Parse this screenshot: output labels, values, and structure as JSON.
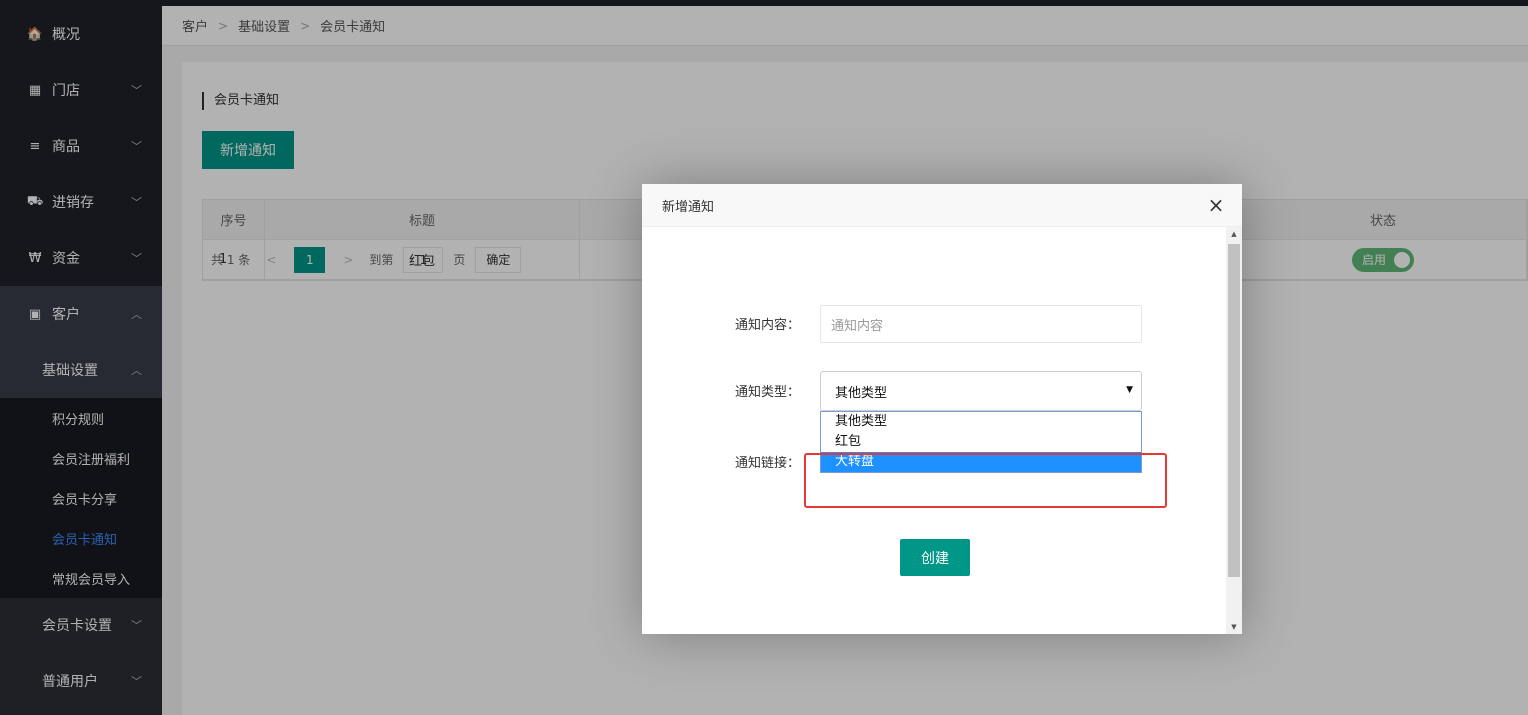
{
  "sidebar": {
    "items": [
      {
        "label": "概况",
        "icon": "home-icon",
        "glyph": "🏠",
        "arrow": ""
      },
      {
        "label": "门店",
        "icon": "building-icon",
        "glyph": "▦",
        "arrow": "﹀"
      },
      {
        "label": "商品",
        "icon": "list-icon",
        "glyph": "≡",
        "arrow": "﹀"
      },
      {
        "label": "进销存",
        "icon": "truck-icon",
        "glyph": "⛟",
        "arrow": "﹀"
      },
      {
        "label": "资金",
        "icon": "won-icon",
        "glyph": "₩",
        "arrow": "﹀"
      },
      {
        "label": "客户",
        "icon": "id-card-icon",
        "glyph": "▣",
        "arrow": "︿"
      }
    ],
    "sub_group": {
      "label": "基础设置",
      "arrow": "︿",
      "leaves": [
        "积分规则",
        "会员注册福利",
        "会员卡分享",
        "会员卡通知",
        "常规会员导入"
      ]
    },
    "more_groups": [
      {
        "label": "会员卡设置",
        "arrow": "﹀"
      },
      {
        "label": "普通用户",
        "arrow": "﹀"
      }
    ]
  },
  "breadcrumb": {
    "items": [
      "客户",
      "基础设置",
      "会员卡通知"
    ],
    "sep": ">"
  },
  "page": {
    "section_title": "会员卡通知",
    "add_button": "新增通知",
    "table": {
      "headers": [
        "序号",
        "标题",
        "",
        "",
        "状态",
        ""
      ],
      "rows": [
        {
          "index": "1",
          "title": "红包",
          "status": "启用"
        }
      ]
    },
    "pager": {
      "total": "共 1 条",
      "prev": "<",
      "current": "1",
      "next": ">",
      "goto_label": "到第",
      "goto_value": "1",
      "page_unit": "页",
      "confirm": "确定"
    }
  },
  "modal": {
    "title": "新增通知",
    "close": "×",
    "fields": {
      "content_label": "通知内容：",
      "content_placeholder": "通知内容",
      "type_label": "通知类型：",
      "type_value": "其他类型",
      "link_label": "通知链接："
    },
    "type_options": [
      "其他类型",
      "红包",
      "大转盘"
    ],
    "selected_option_index": 2,
    "create_button": "创建"
  },
  "colors": {
    "sidebar_bg": "#20222a",
    "primary": "#009688",
    "link_active": "#3b8cff",
    "toggle_on": "#5fb878",
    "highlight_box": "#e53935",
    "option_selected": "#1e90ff"
  }
}
